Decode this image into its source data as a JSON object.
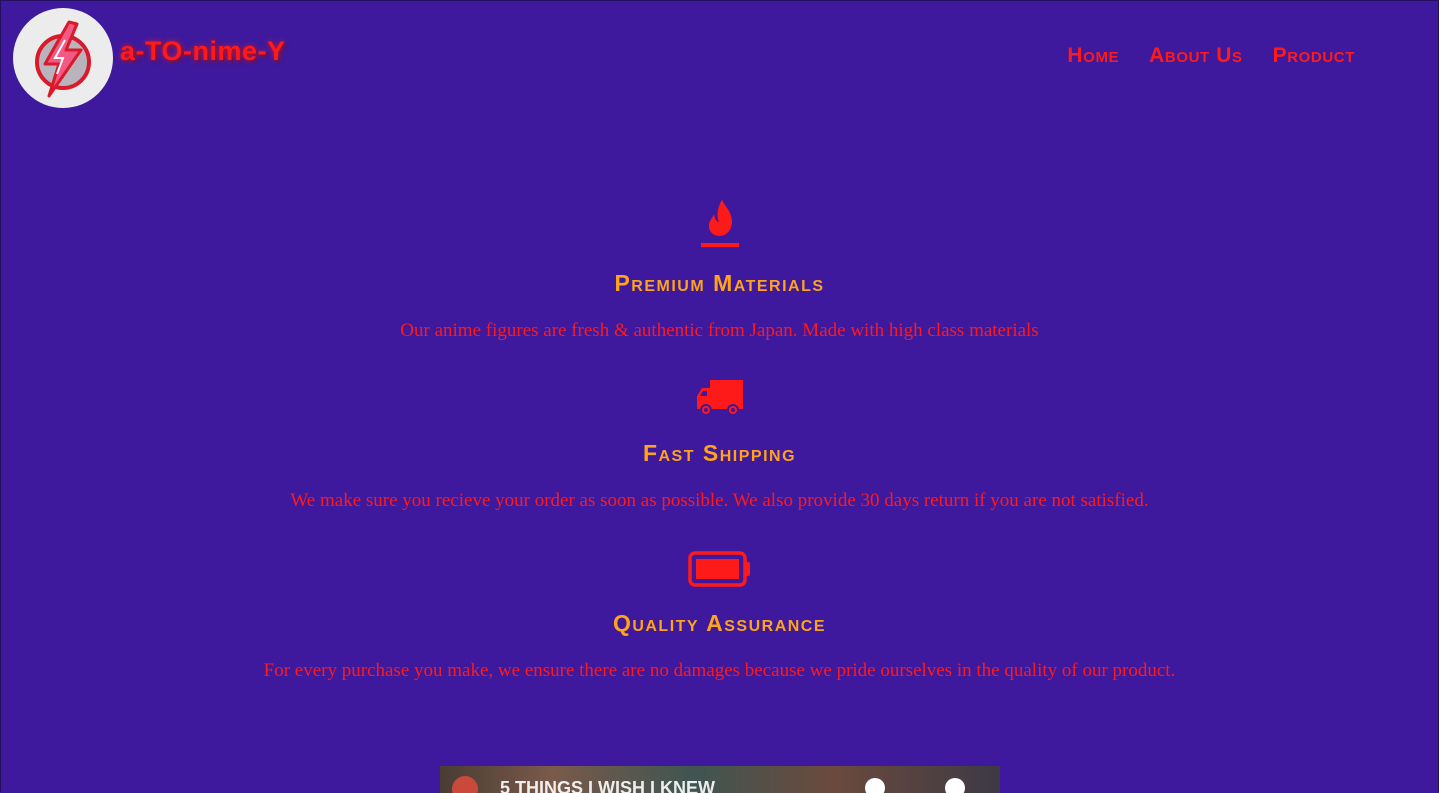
{
  "header": {
    "brand": "a-TO-nime-Y",
    "logo_icon": "lightning-emblem-icon",
    "nav": [
      {
        "label": "Home"
      },
      {
        "label": "About Us"
      },
      {
        "label": "Product"
      }
    ]
  },
  "features": [
    {
      "icon": "fire-icon",
      "title": "Premium Materials",
      "text": "Our anime figures are fresh & authentic from Japan. Made with high class materials"
    },
    {
      "icon": "truck-icon",
      "title": "Fast Shipping",
      "text": "We make sure you recieve your order as soon as possible. We also provide 30 days return if you are not satisfied."
    },
    {
      "icon": "battery-full-icon",
      "title": "Quality Assurance",
      "text": "For every purchase you make, we ensure there are no damages because we pride ourselves in the quality of our product."
    }
  ],
  "video": {
    "icon": "video-embed",
    "title": "5 THINGS I WISH I KNEW"
  },
  "colors": {
    "background": "#3e199d",
    "accent_red": "#ff1a1a",
    "heading_orange": "#ffa31a",
    "logo_bg": "#ececec"
  }
}
